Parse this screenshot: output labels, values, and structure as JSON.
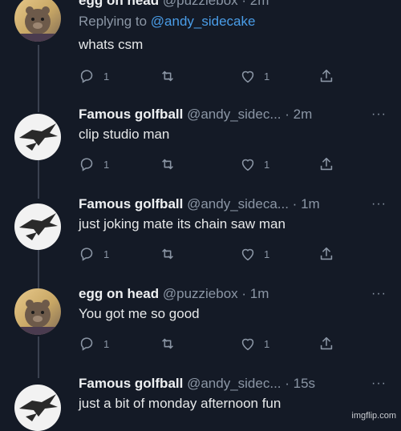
{
  "tweets": [
    {
      "avatar": "bear-avatar",
      "name": "egg on head",
      "handle": "@puzzlebox · 2m",
      "reply_prefix": "Replying to ",
      "reply_mention": "@andy_sidecake",
      "text": "whats csm",
      "replies": "1",
      "likes": "1"
    },
    {
      "avatar": "dragon-avatar",
      "name": "Famous golfball",
      "handle": "@andy_sidec... · 2m",
      "text": "clip studio man",
      "replies": "1",
      "likes": "1"
    },
    {
      "avatar": "dragon-avatar",
      "name": "Famous golfball",
      "handle": "@andy_sideca... · 1m",
      "text": "just joking mate its chain saw man",
      "replies": "1",
      "likes": "1"
    },
    {
      "avatar": "bear-avatar",
      "name": "egg on head",
      "handle": "@puzziebox · 1m",
      "text": "You got me so good",
      "replies": "1",
      "likes": "1"
    },
    {
      "avatar": "dragon-avatar",
      "name": "Famous golfball",
      "handle": "@andy_sidec... · 15s",
      "text": "just a bit of monday afternoon fun"
    }
  ],
  "more_label": "···",
  "watermark": "imgflip.com"
}
